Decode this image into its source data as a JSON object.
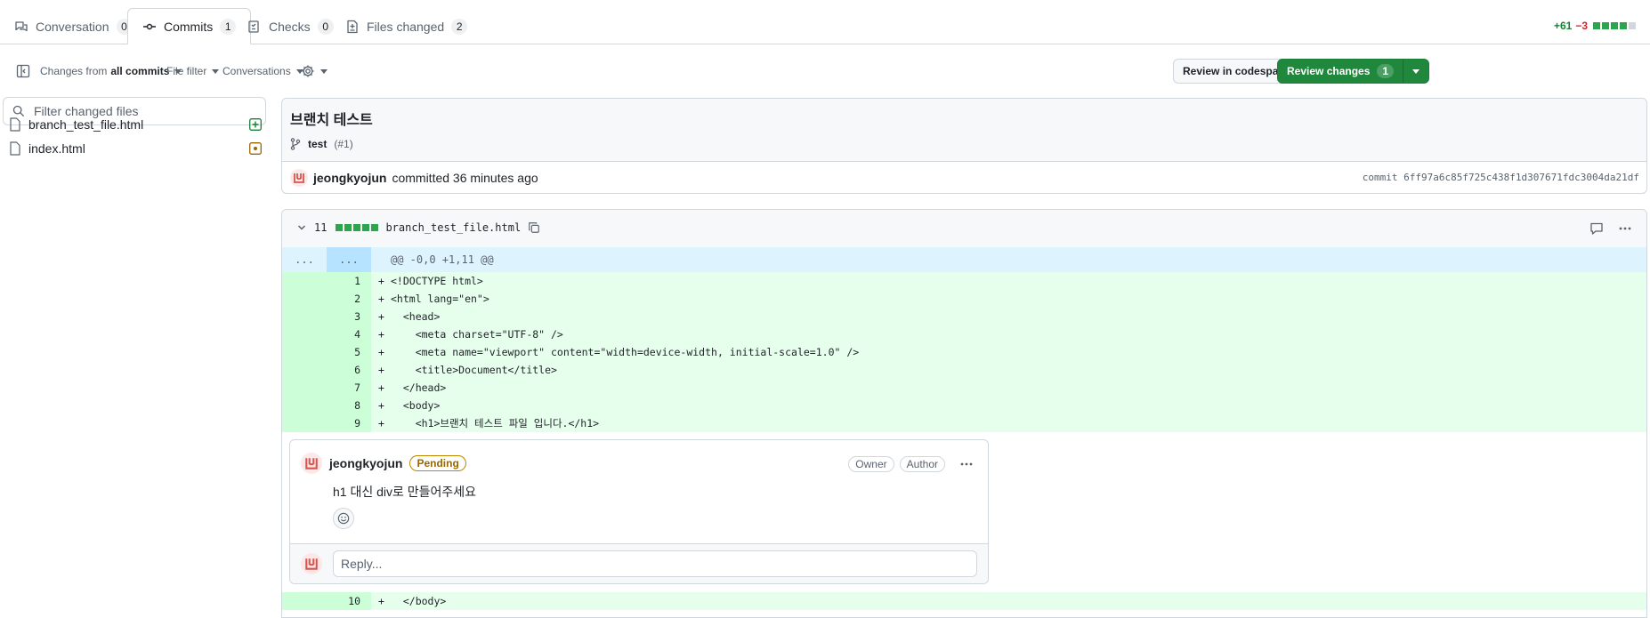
{
  "tabs": [
    {
      "label": "Conversation",
      "count": "0"
    },
    {
      "label": "Commits",
      "count": "1"
    },
    {
      "label": "Checks",
      "count": "0"
    },
    {
      "label": "Files changed",
      "count": "2"
    }
  ],
  "diffstat": {
    "additions": "+61",
    "deletions": "−3",
    "bar": [
      1,
      1,
      1,
      1,
      0
    ]
  },
  "toolbar": {
    "changes_from_prefix": "Changes from",
    "changes_from_value": "all commits",
    "file_filter": "File filter",
    "conversations": "Conversations",
    "review_codespace": "Review in codespace",
    "review_changes": "Review changes",
    "review_changes_count": "1"
  },
  "sidebar": {
    "filter_placeholder": "Filter changed files",
    "files": [
      {
        "name": "branch_test_file.html",
        "status": "added"
      },
      {
        "name": "index.html",
        "status": "modified"
      }
    ]
  },
  "commit": {
    "title": "브랜치 테스트",
    "branch": "test",
    "pr": "(#1)",
    "author": "jeongkyojun",
    "action": "committed 36 minutes ago",
    "sha": "commit 6ff97a6c85f725c438f1d307671fdc3004da21df"
  },
  "diff": {
    "count": "11",
    "filename": "branch_test_file.html",
    "hunk_gutter": "...",
    "hunk": "@@ -0,0 +1,11 @@",
    "lines": [
      {
        "n": "1",
        "code": "<!DOCTYPE html>"
      },
      {
        "n": "2",
        "code": "<html lang=\"en\">"
      },
      {
        "n": "3",
        "code": "  <head>"
      },
      {
        "n": "4",
        "code": "    <meta charset=\"UTF-8\" />"
      },
      {
        "n": "5",
        "code": "    <meta name=\"viewport\" content=\"width=device-width, initial-scale=1.0\" />"
      },
      {
        "n": "6",
        "code": "    <title>Document</title>"
      },
      {
        "n": "7",
        "code": "  </head>"
      },
      {
        "n": "8",
        "code": "  <body>"
      },
      {
        "n": "9",
        "code": "    <h1>브랜치 테스트 파일 입니다.</h1>"
      }
    ],
    "after_line": {
      "n": "10",
      "code": "  </body>"
    }
  },
  "comment": {
    "author": "jeongkyojun",
    "status": "Pending",
    "role_owner": "Owner",
    "role_author": "Author",
    "body": "h1 대신 div로 만들어주세요",
    "reply_placeholder": "Reply..."
  },
  "colors": {
    "accent_green": "#1f883d",
    "added_bg": "#e6ffec",
    "hunk_bg": "#ddf4ff",
    "pending": "#9a6700"
  }
}
